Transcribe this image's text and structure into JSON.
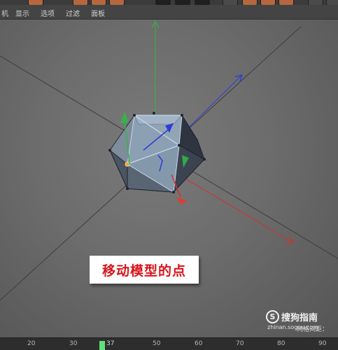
{
  "menu": {
    "items": [
      "机",
      "显示",
      "选项",
      "过滤",
      "面板"
    ]
  },
  "viewport": {
    "caption": "移动模型的点",
    "axis_colors": {
      "x": "#d0342c",
      "y": "#37b24d",
      "z": "#2c3ed8"
    },
    "selected_point_color": "#f0a23a"
  },
  "watermark": {
    "logo_letter": "S",
    "brand": "搜狗指南",
    "url": "zhinan.sogou.com",
    "grid_label": "网格间距："
  },
  "timeline": {
    "ticks": [
      "20",
      "30",
      "50",
      "60",
      "70",
      "80",
      "90"
    ],
    "current_frame": "37"
  }
}
